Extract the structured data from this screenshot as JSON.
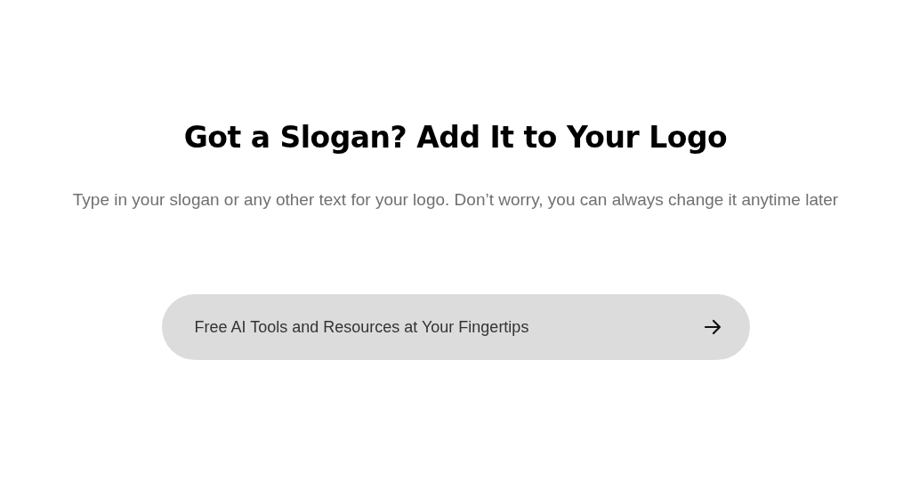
{
  "heading": "Got a Slogan? Add It to Your Logo",
  "description": "Type in your slogan or any other text for your logo. Don’t worry, you can always change it anytime later",
  "slogan_field": {
    "value": "Free AI Tools and Resources at Your Fingertips"
  }
}
